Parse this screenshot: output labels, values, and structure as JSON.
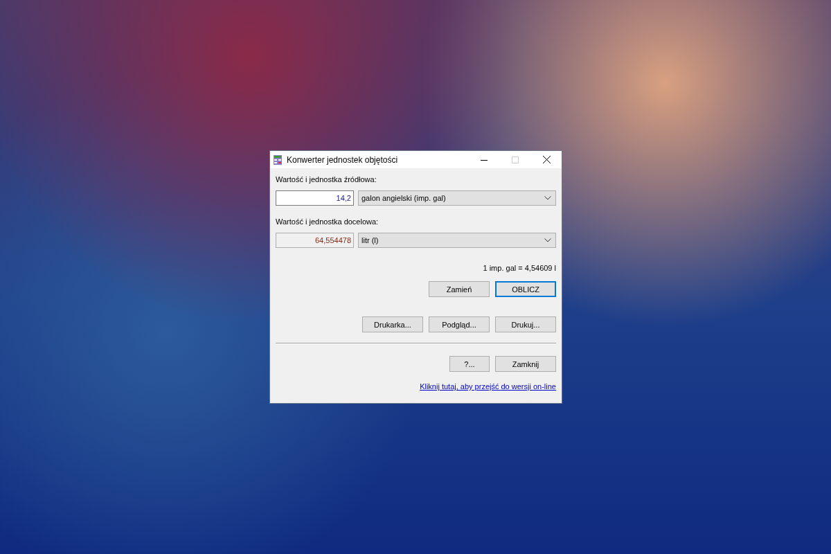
{
  "window": {
    "title": "Konwerter jednostek objętości"
  },
  "source": {
    "label": "Wartość i jednostka źródłowa:",
    "value": "14,2",
    "unit": "galon angielski (imp. gal)"
  },
  "target": {
    "label": "Wartość i jednostka docelowa:",
    "value": "64,554478",
    "unit": "litr (l)"
  },
  "ratio": "1 imp. gal = 4,54609 l",
  "action_buttons": [
    {
      "label": "Zamień",
      "default": false
    },
    {
      "label": "OBLICZ",
      "default": true
    }
  ],
  "print_buttons": [
    {
      "label": "Drukarka...",
      "default": false
    },
    {
      "label": "Podgląd...",
      "default": false
    },
    {
      "label": "Drukuj...",
      "default": false
    }
  ],
  "bottom_buttons": [
    {
      "label": "?...",
      "default": false,
      "kind": "narrow"
    },
    {
      "label": "Zamknij",
      "default": false,
      "kind": "normal"
    }
  ],
  "link": "Kliknij tutaj, aby przejść do wersji on-line"
}
